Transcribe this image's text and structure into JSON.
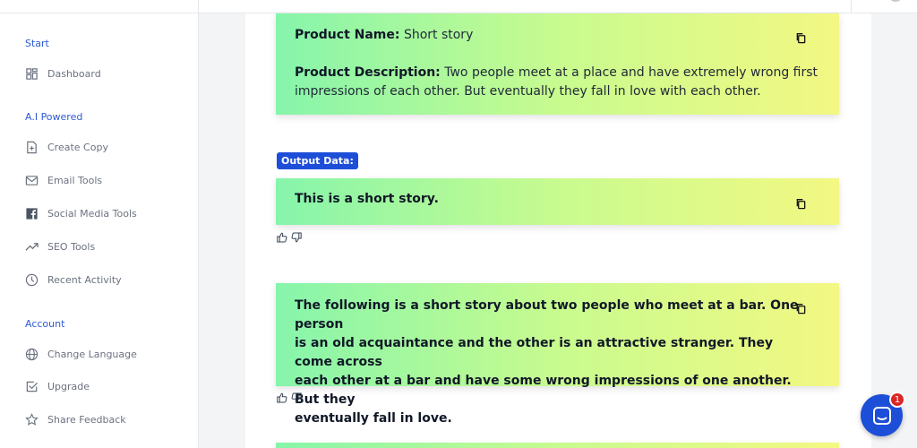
{
  "sidebar": {
    "sections": [
      {
        "title": "Start",
        "items": [
          {
            "label": "Dashboard",
            "icon": "dashboard-icon"
          }
        ]
      },
      {
        "title": "A.I Powered",
        "items": [
          {
            "label": "Create Copy",
            "icon": "file-plus-icon"
          },
          {
            "label": "Email Tools",
            "icon": "mail-icon"
          },
          {
            "label": "Social Media Tools",
            "icon": "facebook-icon"
          },
          {
            "label": "SEO Tools",
            "icon": "trending-up-icon"
          },
          {
            "label": "Recent Activity",
            "icon": "clock-icon"
          }
        ]
      },
      {
        "title": "Account",
        "items": [
          {
            "label": "Change Language",
            "icon": "globe-icon"
          },
          {
            "label": "Upgrade",
            "icon": "checkbox-icon"
          },
          {
            "label": "Share Feedback",
            "icon": "star-icon"
          }
        ]
      }
    ]
  },
  "input": {
    "product_name_label": "Product Name:",
    "product_name_value": "Short story",
    "product_description_label": "Product Description:",
    "product_description_line1": "Two people meet at a place and have extremely wrong first",
    "product_description_line2": "impressions of each other. But eventually they fall in love with each other."
  },
  "output_badge": "Output Data:",
  "outputs": [
    {
      "lines": [
        "This is a short story."
      ]
    },
    {
      "lines": [
        "The following is a short story about two people who meet at a bar. One person",
        "is an old acquaintance and the other is an attractive stranger. They come across",
        "each other at a bar and have some wrong impressions of one another. But they",
        "eventually fall in love."
      ]
    }
  ],
  "chat": {
    "badge_count": "1"
  },
  "colors": {
    "accent": "#1d4ed8",
    "section_title": "#2f5bd3",
    "gradient_start": "#86f5ab",
    "gradient_end": "#f3f882"
  }
}
